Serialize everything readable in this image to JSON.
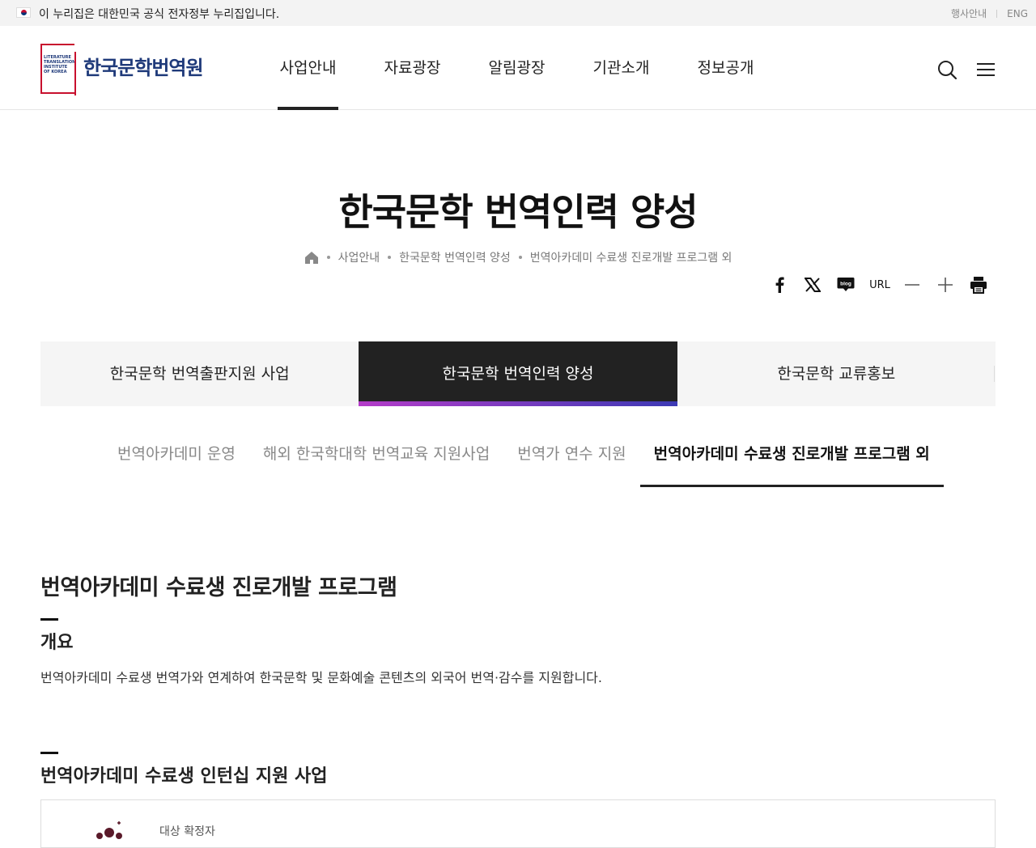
{
  "gov_banner": {
    "text": "이 누리집은 대한민국 공식 전자정부 누리집입니다.",
    "links": [
      "행사안내",
      "ENG"
    ]
  },
  "header": {
    "logo_en": "LITERATURE TRANSLATION INSTITUTE OF KOREA",
    "logo_ko": "한국문학번역원",
    "nav": [
      "사업안내",
      "자료광장",
      "알림광장",
      "기관소개",
      "정보공개"
    ],
    "active_nav_index": 0,
    "search_icon": "search-icon",
    "menu_icon": "hamburger-menu-icon"
  },
  "page": {
    "title": "한국문학 번역인력 양성",
    "breadcrumb": [
      "사업안내",
      "한국문학 번역인력 양성",
      "번역아카데미 수료생 진로개발 프로그램 외"
    ],
    "share": {
      "url_label": "URL",
      "icons": [
        "facebook-icon",
        "x-icon",
        "blog-icon",
        "url-icon",
        "zoom-out-icon",
        "zoom-in-icon",
        "print-icon"
      ],
      "blog_label": "blog"
    }
  },
  "tabs": [
    "한국문학 번역출판지원 사업",
    "한국문학 번역인력 양성",
    "한국문학 교류홍보"
  ],
  "active_tab_index": 1,
  "subtabs": [
    "번역아카데미 운영",
    "해외 한국학대학 번역교육 지원사업",
    "번역가 연수 지원",
    "번역아카데미 수료생 진로개발 프로그램 외"
  ],
  "active_subtab_index": 3,
  "content": {
    "main_heading": "번역아카데미 수료생 진로개발 프로그램",
    "section1_heading": "개요",
    "section1_text": "번역아카데미 수료생 번역가와 연계하여 한국문학 및 문화예술 콘텐츠의 외국어 번역·감수를 지원합니다.",
    "section2_heading": "번역아카데미 수료생 인턴십 지원 사업",
    "box_label": "대상 확정자"
  },
  "colors": {
    "brand_navy": "#1f3a7a",
    "brand_red": "#c8102e",
    "active_tab_bg": "#222222",
    "tab_gradient_start": "#b43cc8",
    "tab_gradient_end": "#3c3ab4"
  }
}
